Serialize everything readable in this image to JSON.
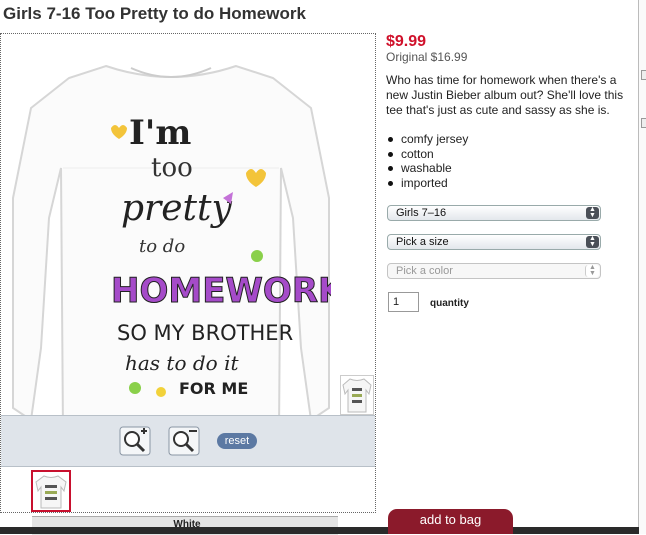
{
  "product": {
    "title": "Girls 7-16 Too Pretty to do Homework",
    "price": "$9.99",
    "original_price": "Original $16.99",
    "description": "Who has time for homework when there's a new Justin Bieber album out? She'll love this tee that's just as cute and sassy as she is.",
    "features": [
      "comfy jersey",
      "cotton",
      "washable",
      "imported"
    ],
    "shirt_text": [
      "I'm",
      "too",
      "pretty",
      "to do",
      "HOMEWORK",
      "SO MY BROTHER",
      "has to do it",
      "FOR ME"
    ]
  },
  "options": {
    "size_range": "Girls 7–16",
    "size": "Pick a size",
    "color": "Pick a color",
    "quantity_value": "1",
    "quantity_label": "quantity"
  },
  "viewer": {
    "reset_label": "reset",
    "swatch_label": "White"
  },
  "actions": {
    "add_to_bag": "add to bag"
  },
  "colors": {
    "price": "#d0112b",
    "add_to_bag_bg": "#8b1a2b",
    "reset_bg": "#5c79a3"
  }
}
